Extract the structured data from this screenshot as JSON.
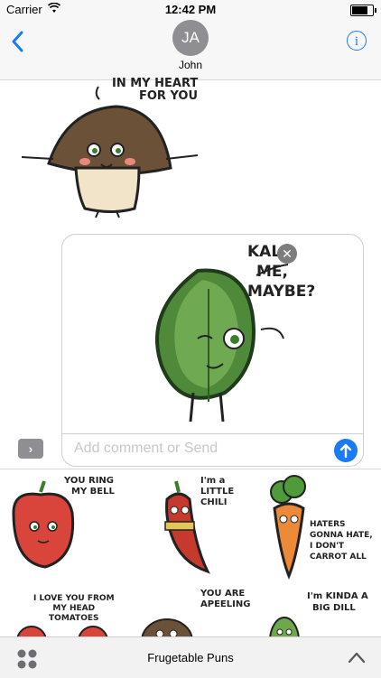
{
  "status": {
    "carrier": "Carrier",
    "time": "12:42 PM",
    "battery_level": 0.85
  },
  "header": {
    "avatar_initials": "JA",
    "contact_name": "John"
  },
  "conversation": {
    "mushroom_caption": [
      "IN MY HEART",
      "FOR YOU"
    ],
    "kale_caption": [
      "KALE",
      "ME,",
      "MAYBE?"
    ]
  },
  "compose": {
    "placeholder": "Add comment or Send"
  },
  "drawer": {
    "stickers": [
      {
        "name": "bell-pepper",
        "caption": [
          "YOU RING",
          "MY BELL"
        ]
      },
      {
        "name": "chili",
        "caption": [
          "I'm a",
          "LITTLE",
          "CHILI"
        ]
      },
      {
        "name": "carrot",
        "caption": [
          "HATERS",
          "GONNA HATE,",
          "I DON'T",
          "CARROT ALL"
        ]
      },
      {
        "name": "tomatoes",
        "caption": [
          "I LOVE YOU FROM",
          "MY HEAD",
          "TOMATOES"
        ]
      },
      {
        "name": "potato",
        "caption": [
          "YOU ARE",
          "APEELING"
        ]
      },
      {
        "name": "pickle",
        "caption": [
          "I'm KINDA A",
          "BIG DILL"
        ]
      }
    ]
  },
  "bottom_bar": {
    "title": "Frugetable Puns"
  },
  "colors": {
    "accent": "#1a7cf5",
    "avatar": "#8e8e93"
  }
}
